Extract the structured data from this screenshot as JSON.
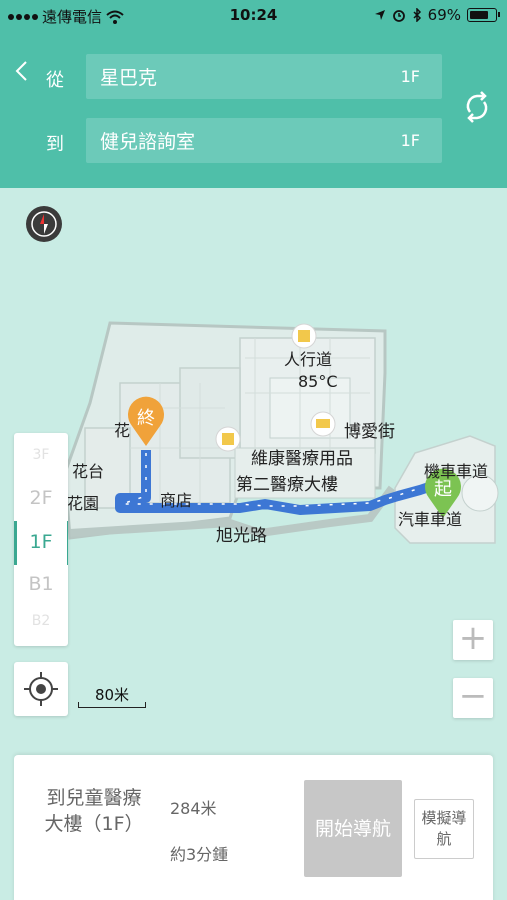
{
  "status_bar": {
    "carrier": "遠傳電信",
    "time": "10:24",
    "battery": "69%",
    "battery_level": 0.69
  },
  "header": {
    "from_label": "從",
    "to_label": "到",
    "from_value": "星巴克",
    "from_floor": "1F",
    "to_value": "健兒諮詢室",
    "to_floor": "1F",
    "icons": [
      "back-chevron-icon",
      "swap-icon"
    ]
  },
  "map": {
    "labels": {
      "road_people": "人行道",
      "temperature": "85°C",
      "bo_ai_street": "博愛街",
      "flower_bed": "花台",
      "flower_bed_partial": "花",
      "garden": "花園",
      "shop": "商店",
      "weikang": "維康醫療用品",
      "second_building": "第二醫療大樓",
      "xuguang_road": "旭光路",
      "motor_lane_top": "機車車道",
      "motor_lane_bottom": "汽車車道"
    },
    "markers": {
      "start": "起",
      "end": "終"
    },
    "colors": {
      "start_marker": "#7cc352",
      "end_marker": "#f0a23a",
      "route": "#3d77d4",
      "building": "#e8efee",
      "poi": "#f2c84b"
    },
    "floors": [
      "2F",
      "1F",
      "B1"
    ],
    "active_floor": "1F",
    "scale_text": "80米",
    "zoom_in": "+",
    "zoom_out": "−"
  },
  "panel": {
    "destination": "到兒童醫療大樓（1F）",
    "distance": "284米",
    "eta": "約3分鍾",
    "start_nav": "開始導航",
    "simulate_nav": "模擬導航"
  }
}
